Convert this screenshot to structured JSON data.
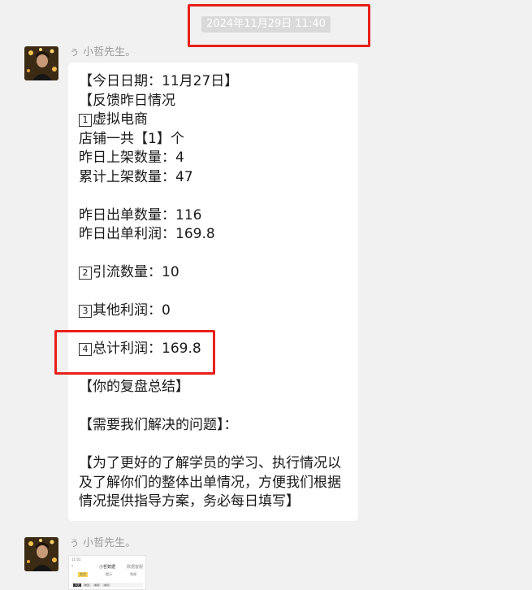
{
  "chat": {
    "timestamp": "2024年11月29日 11:40",
    "messages": [
      {
        "sender": "ぅ 小哲先生。",
        "lines": [
          "【今日日期：11月27日】",
          "【反馈昨日情况",
          "1|虚拟电商",
          "店铺一共【1】个",
          "昨日上架数量：4",
          "累计上架数量：47",
          "",
          "昨日出单数量：116",
          "昨日出单利润：169.8",
          "",
          "2|引流数量：10",
          "",
          "3|其他利润：0",
          "",
          "4|总计利润：169.8",
          "",
          "【你的复盘总结】",
          "",
          "【需要我们解决的问题】：",
          "",
          "【为了更好的了解学员的学习、执行情况以",
          "及了解你们的整体出单情况，方便我们根据",
          "情况提供指导方案，务必每日填写】"
        ]
      },
      {
        "sender": "ぅ 小哲先生。",
        "image": {
          "status_time": "11:01",
          "title": "小哲数据",
          "more": "数据客服",
          "tabs": [
            "发货",
            "提示",
            "利润"
          ],
          "chips": [
            "今天",
            "昨天",
            "本周",
            "本月"
          ]
        }
      }
    ]
  },
  "colors": {
    "annotation": "#e8201a",
    "background": "#f1f1f1",
    "bubble": "#ffffff"
  }
}
